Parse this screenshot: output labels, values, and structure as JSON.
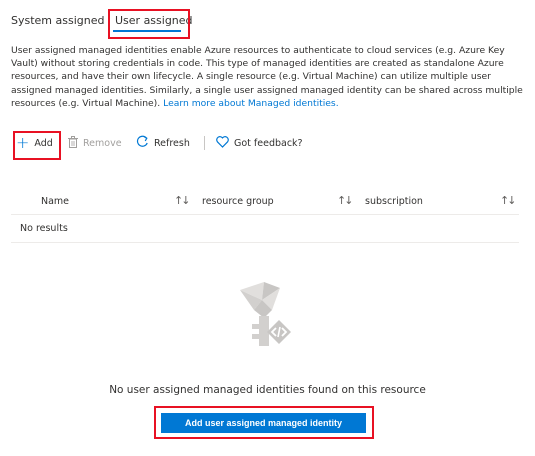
{
  "tabs": {
    "system_assigned": "System assigned",
    "user_assigned": "User assigned",
    "active": "User assigned"
  },
  "description": {
    "text": "User assigned managed identities enable Azure resources to authenticate to cloud services (e.g. Azure Key Vault) without storing credentials in code. This type of managed identities are created as standalone Azure resources, and have their own lifecycle. A single resource (e.g. Virtual Machine) can utilize multiple user assigned managed identities. Similarly, a single user assigned managed identity can be shared across multiple resources (e.g. Virtual Machine).",
    "link": "Learn more about Managed identities."
  },
  "toolbar": {
    "add_label": "Add",
    "remove_label": "Remove",
    "refresh_label": "Refresh",
    "feedback_label": "Got feedback?"
  },
  "table": {
    "columns": [
      "Name",
      "resource group",
      "subscription"
    ],
    "empty_row": "No results"
  },
  "empty_state": {
    "message": "No user assigned managed identities found on this resource",
    "button_label": "Add user assigned managed identity"
  },
  "colors": {
    "accent": "#0078d4",
    "highlight": "#e81123",
    "text": "#323130",
    "disabled": "#a19f9d"
  }
}
